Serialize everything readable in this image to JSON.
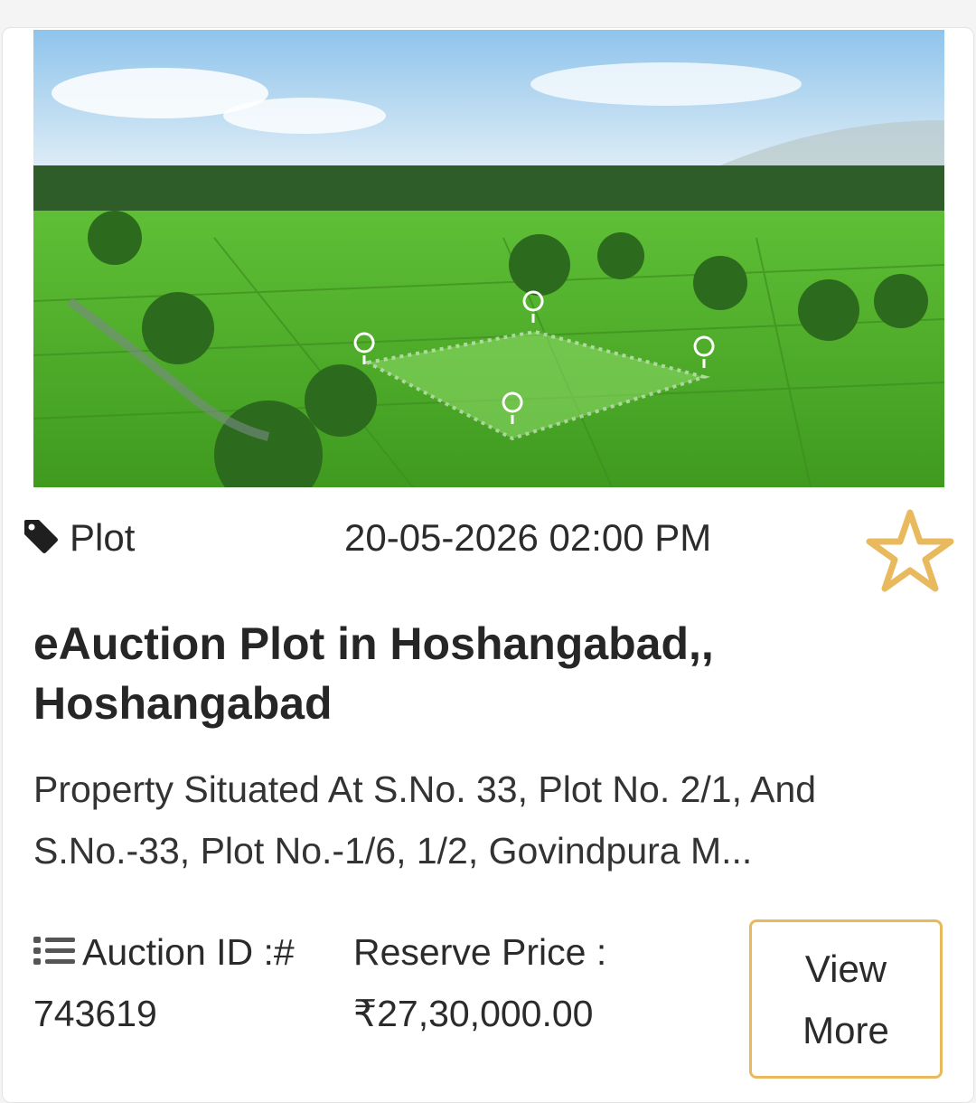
{
  "listing": {
    "image_alt": "Aerial view of green rice fields with a marked plot",
    "category": "Plot",
    "category_icon": "tag-icon",
    "auction_datetime": "20-05-2026 02:00 PM",
    "favorite_icon": "star-outline-icon",
    "title": "eAuction Plot in Hoshangabad,, Hoshangabad",
    "description": "Property Situated At S.No. 33, Plot No. 2/1, And S.No.-33, Plot No.-1/6, 1/2, Govindpura M...",
    "auction_id_label": "Auction ID :#",
    "auction_id_icon": "list-icon",
    "auction_id_value": "743619",
    "reserve_price_label": "Reserve Price :",
    "reserve_price_value": "₹27,30,000.00",
    "view_more_label": "View More"
  },
  "colors": {
    "accent": "#E9B95E",
    "text": "#2B2B2B",
    "field_green": "#4FBF2C"
  }
}
